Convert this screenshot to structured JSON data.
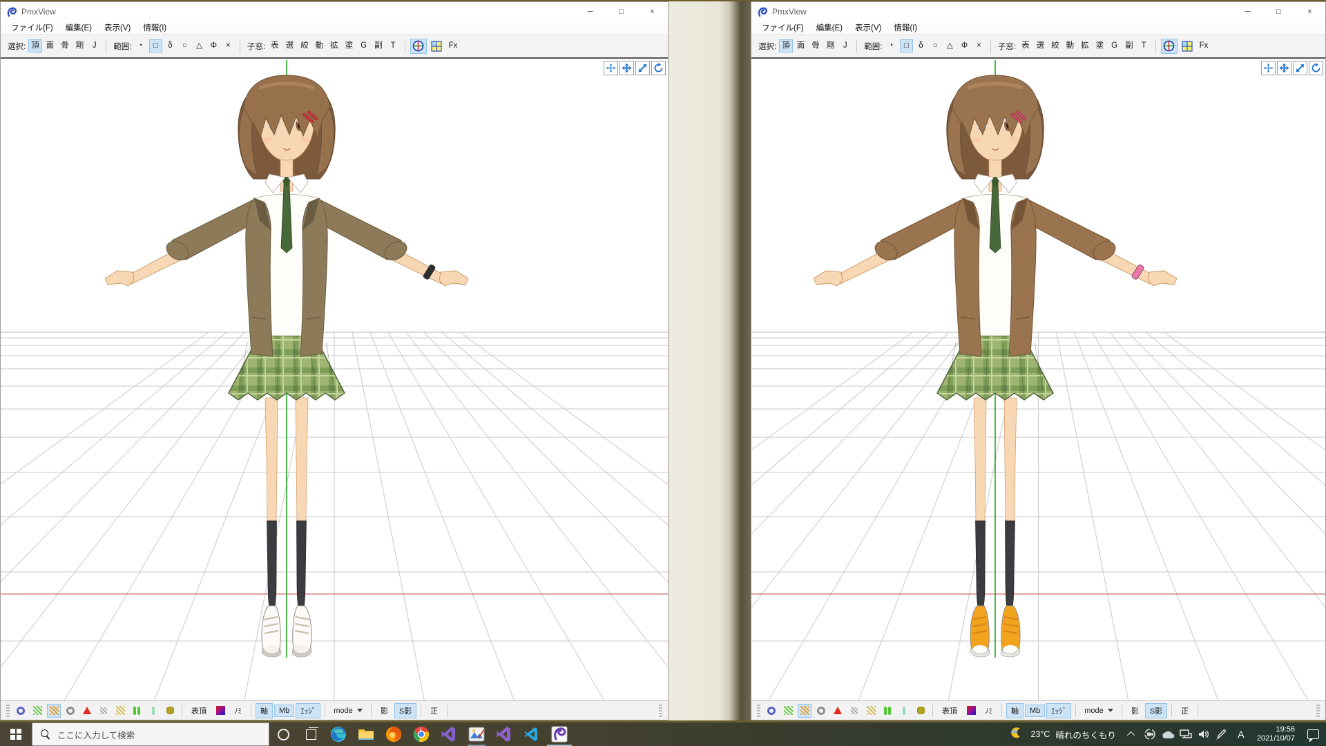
{
  "window_common": {
    "title": "PmxView",
    "menus": [
      "ファイル(F)",
      "編集(E)",
      "表示(V)",
      "情報(I)"
    ],
    "controls": {
      "minimize": "─",
      "maximize": "□",
      "close": "×"
    },
    "toolbar": {
      "select_label": "選択:",
      "select_items": [
        "頂",
        "面",
        "骨",
        "剛",
        "J"
      ],
      "range_label": "範囲:",
      "range_items": [
        "・",
        "□",
        "δ",
        "○",
        "△",
        "Φ",
        "×"
      ],
      "subwin_label": "子窓:",
      "subwin_items": [
        "表",
        "選",
        "絞",
        "動",
        "拡",
        "塗",
        "G",
        "副",
        "T"
      ],
      "gizmo_icon": "axis-gizmo-icon",
      "quad_icon": "quad-view-icon",
      "fx_label": "Fx"
    },
    "nav_icons": [
      "pan-camera-icon",
      "move-icon",
      "zoom-icon",
      "rotate-icon"
    ],
    "statusbar": {
      "btn_vertex_display": "表頂",
      "btn_nomi": "ﾉﾐ",
      "toggle_axis": "軸",
      "toggle_mb": "Mb",
      "toggle_edge": "ｴｯｼﾞ",
      "mode_label": "mode",
      "toggle_shadow": "影",
      "toggle_selfshadow": "S影",
      "toggle_front": "正"
    }
  },
  "windows": [
    {
      "side": "left",
      "model_colors": {
        "hair": "#96714b",
        "jacket": "#8c7a59",
        "jacket-dk": "#6a5c40",
        "tie": "#476838",
        "band": "#2c2c32",
        "shoe": "#fbfaf6",
        "toe": "#f4f2ea",
        "sole": "#cfccc4",
        "lace": "#c6c0b0",
        "clip": "#c03a3a",
        "skin": "#f8d7b4",
        "sock": "#3b3b40"
      }
    },
    {
      "side": "right",
      "model_colors": {
        "hair": "#9a7450",
        "jacket": "#99744e",
        "jacket-dk": "#755535",
        "tie": "#476838",
        "band": "#ef74a8",
        "shoe": "#f2a41e",
        "toe": "#ffffff",
        "sole": "#e8e6e0",
        "lace": "#de8415",
        "clip": "#cc4a68",
        "skin": "#f8d7b4",
        "sock": "#3b3b40"
      }
    }
  ],
  "viewport_colors": {
    "grid": "#c9c9c9",
    "x_axis_red": "#d26a6a",
    "y_axis_green": "#12a012"
  },
  "taskbar": {
    "search_placeholder": "ここに入力して検索",
    "apps": [
      "edge",
      "file-explorer",
      "firefox",
      "chrome",
      "visual-studio",
      "image-viewer",
      "visual-studio-2",
      "vscode",
      "pmx-editor"
    ],
    "weather_temp": "23°C",
    "weather_desc": "晴れのちくもり",
    "ime_mode": "A",
    "time": "19:56",
    "date": "2021/10/07"
  }
}
